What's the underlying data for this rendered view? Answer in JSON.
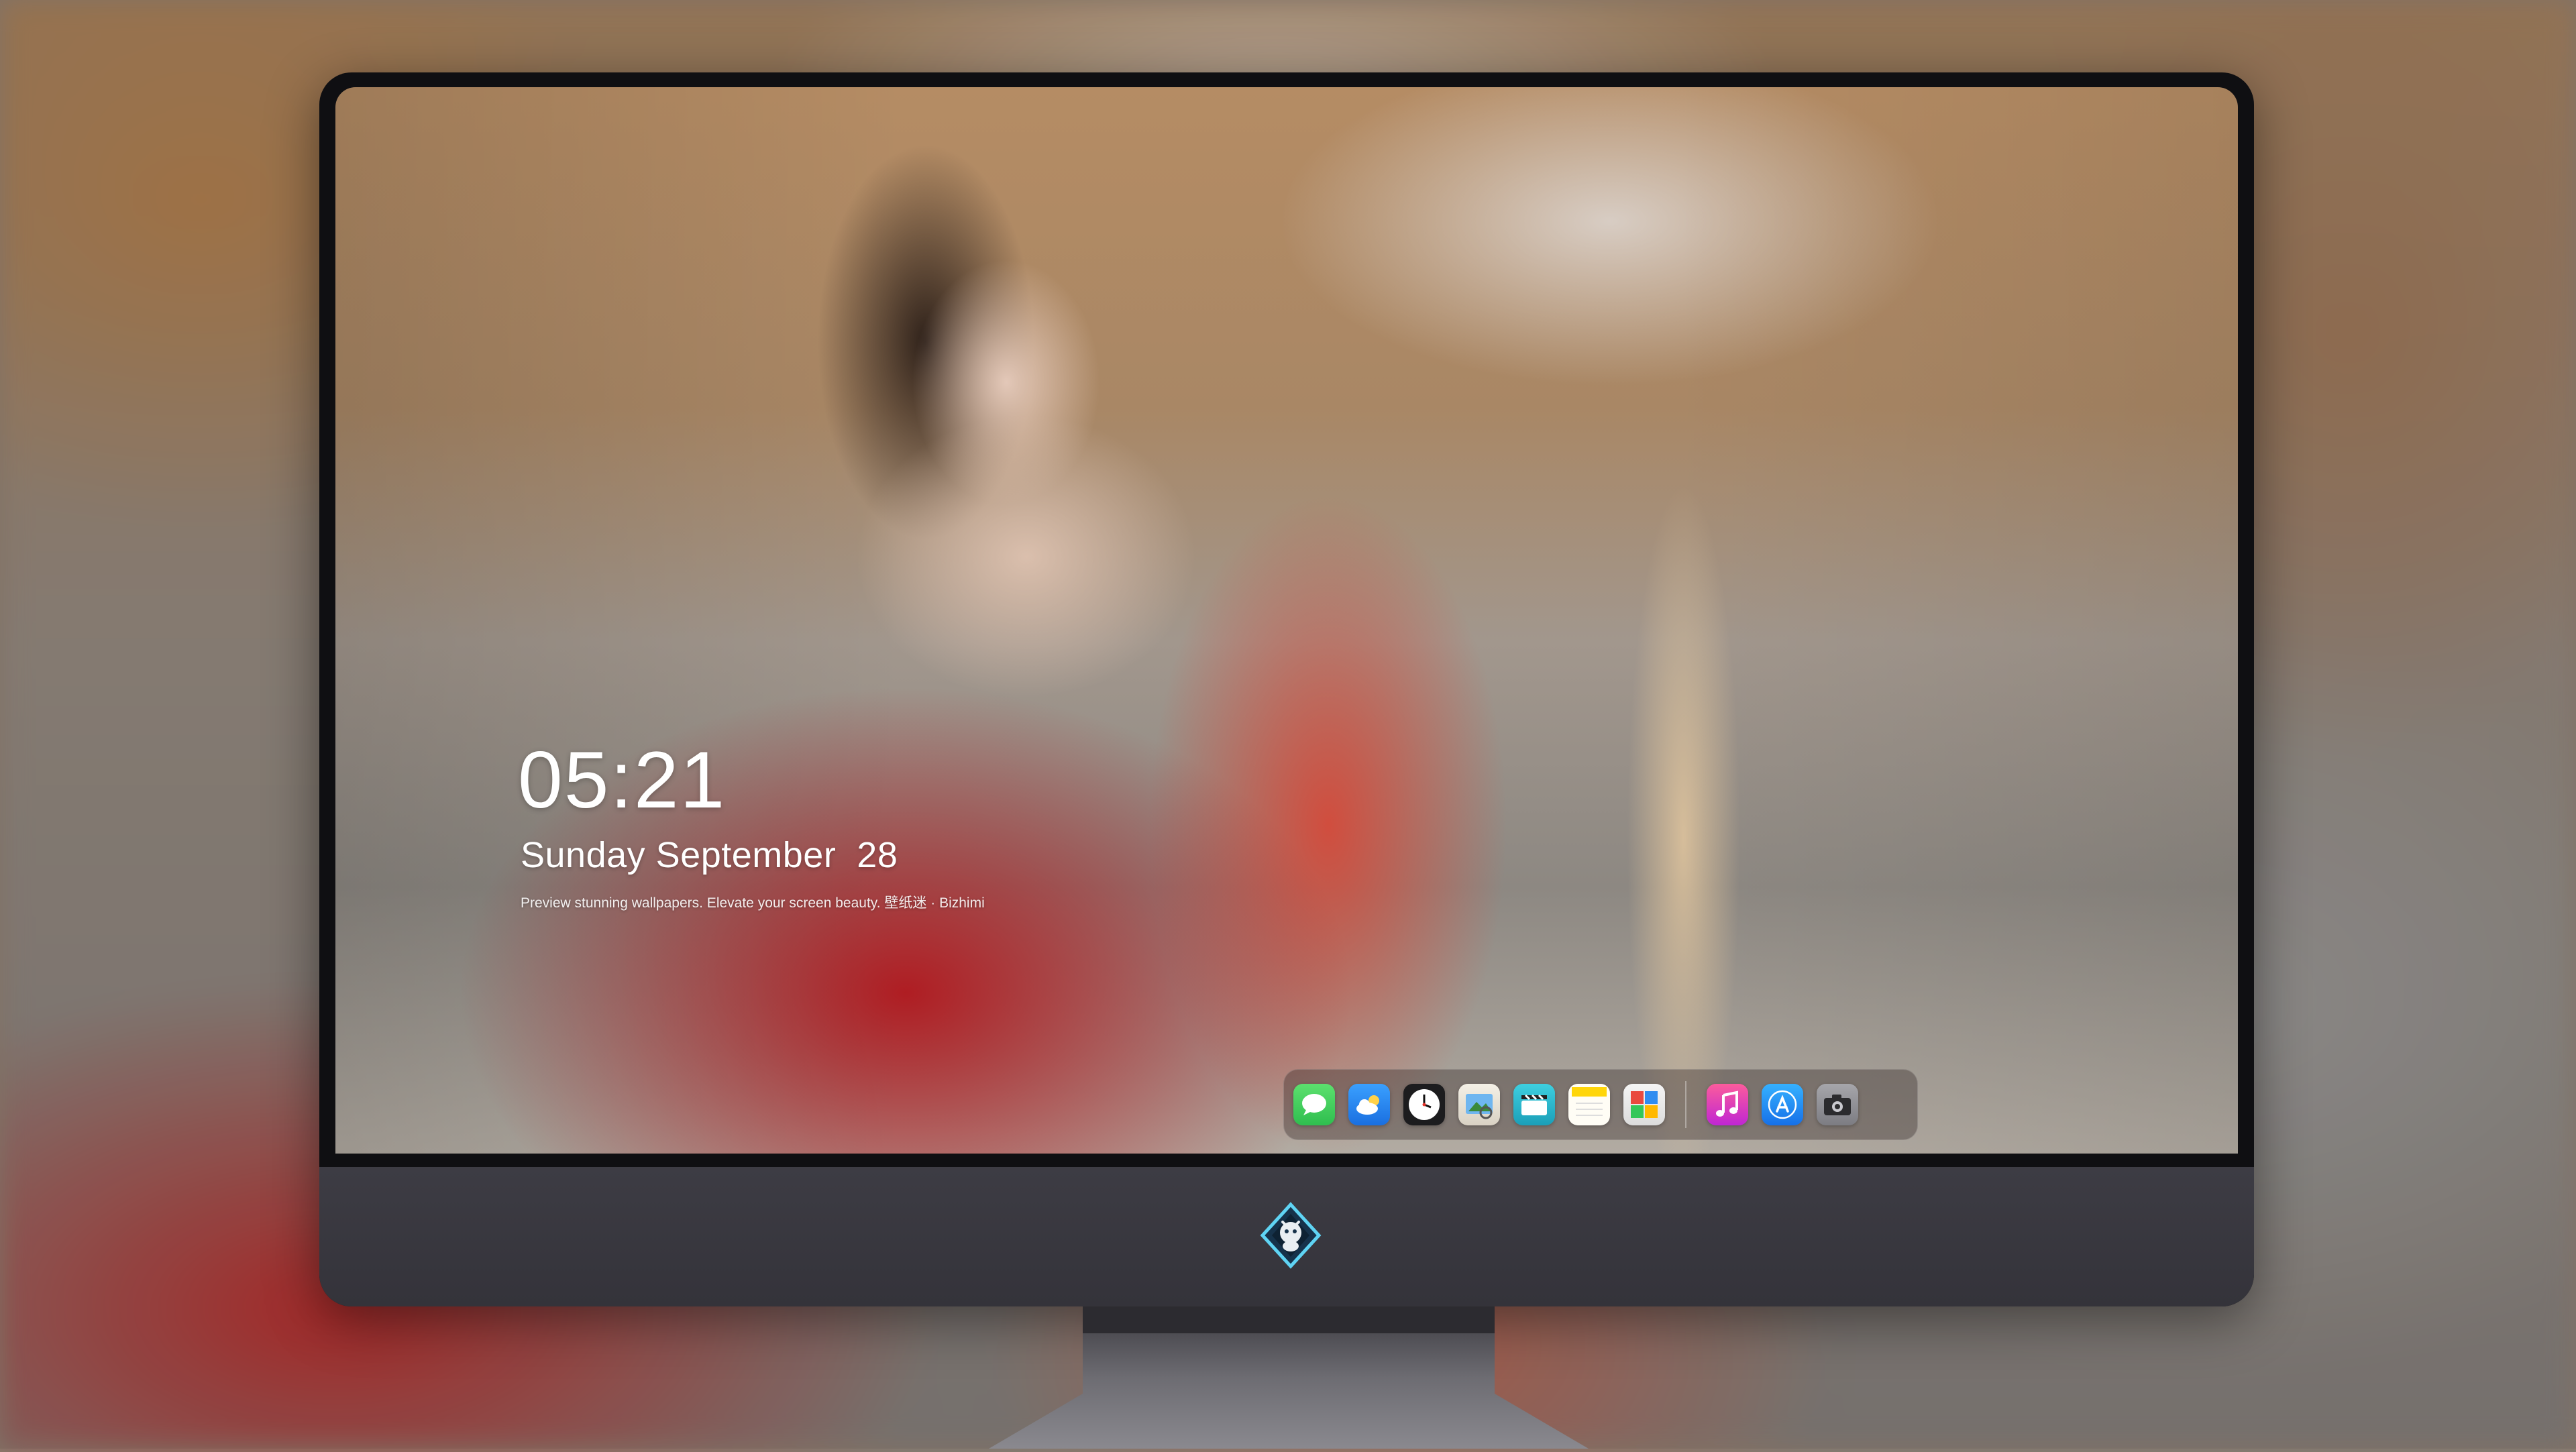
{
  "lockscreen": {
    "time": "05:21",
    "date": "Sunday September  28",
    "tagline": "Preview stunning wallpapers. Elevate your screen beauty. 壁纸迷 · Bizhimi"
  },
  "dock": {
    "apps": [
      {
        "name": "Messages",
        "icon": "message-bubble-icon",
        "color": "#34c759"
      },
      {
        "name": "Weather",
        "icon": "cloud-sun-icon",
        "color": "#2f8cf0"
      },
      {
        "name": "Clock",
        "icon": "clock-icon",
        "color": "#1c1c1e"
      },
      {
        "name": "Preview",
        "icon": "photo-viewer-icon",
        "color": "#5aa0e8"
      },
      {
        "name": "Clips",
        "icon": "clapperboard-icon",
        "color": "#29b6c8"
      },
      {
        "name": "Notes",
        "icon": "notes-icon",
        "color": "#ffd60a"
      },
      {
        "name": "Photo Booth",
        "icon": "photo-grid-icon",
        "color": "#e94a3f"
      },
      {
        "name": "Music",
        "icon": "music-note-icon",
        "color": "#fa2d8c"
      },
      {
        "name": "App Store",
        "icon": "app-store-icon",
        "color": "#1b8cf5"
      },
      {
        "name": "Camera",
        "icon": "camera-icon",
        "color": "#8e8e93"
      }
    ]
  },
  "colors": {
    "bezel": "#0f0f12",
    "chin": "#3a3940",
    "stand": "#6d6c72"
  }
}
